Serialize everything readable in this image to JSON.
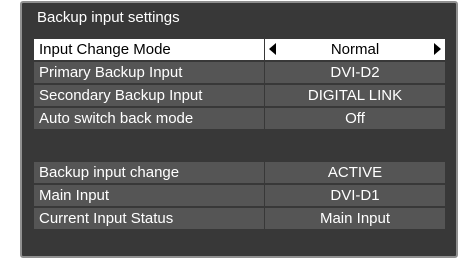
{
  "title": "Backup input settings",
  "rows": [
    {
      "label": "Input Change Mode",
      "value": "Normal"
    },
    {
      "label": "Primary Backup Input",
      "value": "DVI-D2"
    },
    {
      "label": "Secondary Backup Input",
      "value": "DIGITAL LINK"
    },
    {
      "label": "Auto switch back mode",
      "value": "Off"
    },
    {
      "label": "Backup input change",
      "value": "ACTIVE"
    },
    {
      "label": "Main Input",
      "value": "DVI-D1"
    },
    {
      "label": "Current Input Status",
      "value": "Main Input"
    }
  ],
  "icons": {
    "prev": "left-triangle-icon",
    "next": "right-triangle-icon"
  },
  "colors": {
    "panel": "#383838",
    "row": "#555555",
    "selected": "#ffffff",
    "border": "#909090"
  }
}
